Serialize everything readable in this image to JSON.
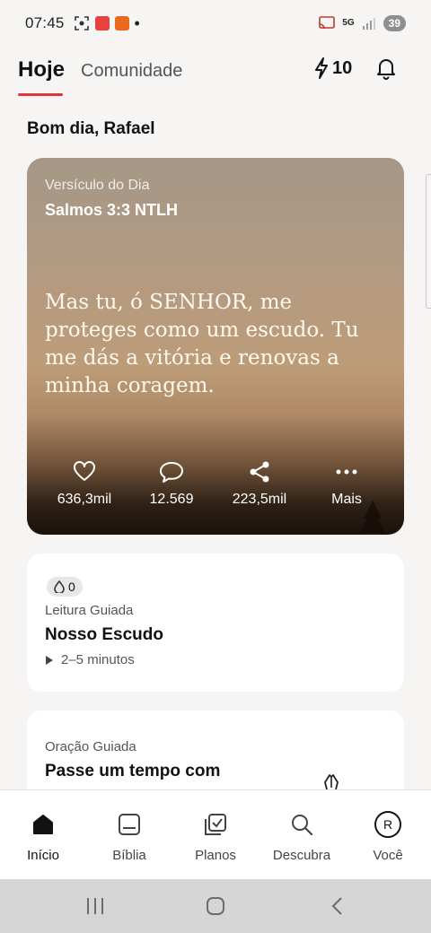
{
  "status_bar": {
    "time": "07:45",
    "battery": "39",
    "network": "5G"
  },
  "header": {
    "tab_today": "Hoje",
    "tab_community": "Comunidade",
    "streak_count": "10"
  },
  "greeting": "Bom dia, Rafael",
  "verse_card": {
    "label": "Versículo do Dia",
    "reference": "Salmos 3:3 NTLH",
    "text": "Mas tu, ó SENHOR, me proteges como um escudo. Tu me dás a vitória e renovas a minha coragem.",
    "actions": {
      "likes": "636,3mil",
      "comments": "12.569",
      "shares": "223,5mil",
      "more": "Mais"
    }
  },
  "guided_reading": {
    "count": "0",
    "kind": "Leitura Guiada",
    "title": "Nosso Escudo",
    "duration": "2–5 minutos"
  },
  "guided_prayer": {
    "kind": "Oração Guiada",
    "title": "Passe um tempo com"
  },
  "bottom_nav": {
    "home": "Início",
    "bible": "Bíblia",
    "plans": "Planos",
    "discover": "Descubra",
    "you": "Você",
    "avatar_letter": "R"
  },
  "colors": {
    "accent": "#e2333b",
    "text": "#121212",
    "background": "#f6f5f4"
  }
}
